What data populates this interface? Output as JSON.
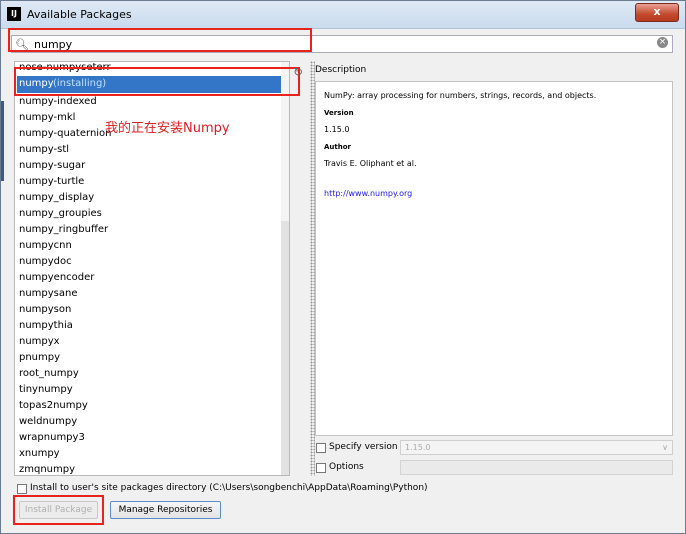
{
  "window": {
    "title": "Available Packages",
    "app_icon": "IJ",
    "close_label": "x"
  },
  "search": {
    "value": "numpy"
  },
  "packages": {
    "partial_top": "nose-numpyseterr",
    "selected": {
      "name": "numpy",
      "status": "(installing)"
    },
    "items": [
      "numpy-indexed",
      "numpy-mkl",
      "numpy-quaternion",
      "numpy-stl",
      "numpy-sugar",
      "numpy-turtle",
      "numpy_display",
      "numpy_groupies",
      "numpy_ringbuffer",
      "numpycnn",
      "numpydoc",
      "numpyencoder",
      "numpysane",
      "numpyson",
      "numpythia",
      "numpyx",
      "pnumpy",
      "root_numpy",
      "tinynumpy",
      "topas2numpy",
      "weldnumpy",
      "wrapnumpy3",
      "xnumpy",
      "zmqnumpy"
    ]
  },
  "annotation": "我的正在安装Numpy",
  "description": {
    "label": "Description",
    "summary": "NumPy: array processing for numbers, strings, records, and objects.",
    "version_heading": "Version",
    "version": "1.15.0",
    "author_heading": "Author",
    "author": "Travis E. Oliphant et al.",
    "url": "http://www.numpy.org"
  },
  "options": {
    "specify_version_label": "Specify version",
    "specify_version_value": "1.15.0",
    "options_label": "Options",
    "install_to_user_label": "Install to user's site packages directory (C:\\Users\\songbenchi\\AppData\\Roaming\\Python)"
  },
  "buttons": {
    "install": "Install Package",
    "manage": "Manage Repositories"
  }
}
